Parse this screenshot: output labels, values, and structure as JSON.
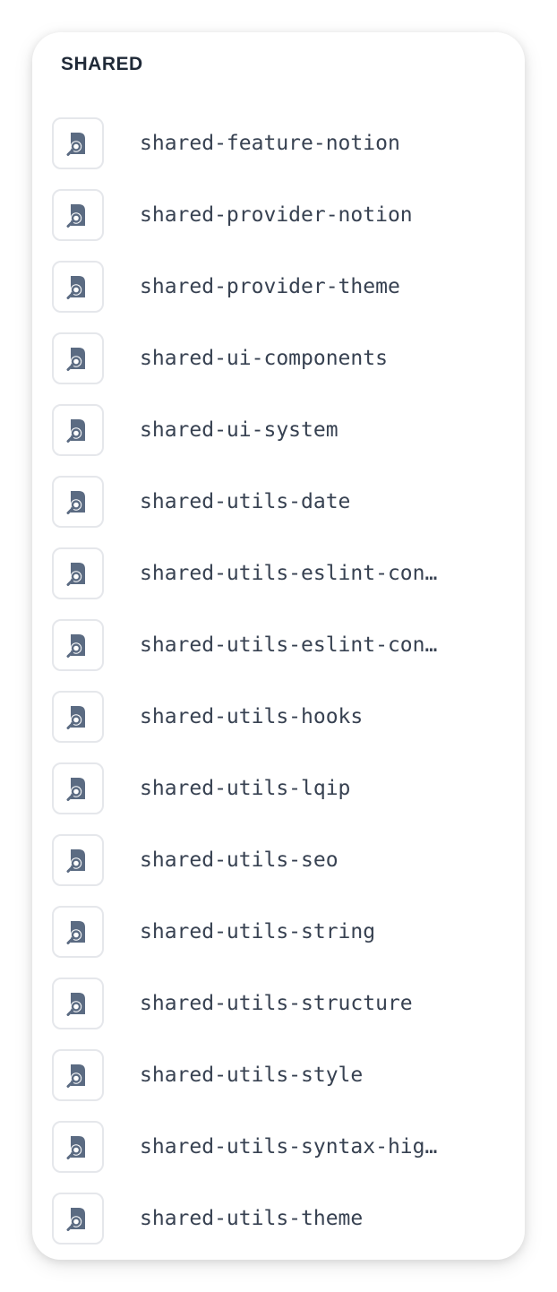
{
  "section": {
    "title": "SHARED"
  },
  "icon": "library-search-icon",
  "colors": {
    "icon": "#5b6b82",
    "text": "#374151",
    "title": "#1f2937",
    "border": "#e5e7eb"
  },
  "items": [
    {
      "label": "shared-feature-notion"
    },
    {
      "label": "shared-provider-notion"
    },
    {
      "label": "shared-provider-theme"
    },
    {
      "label": "shared-ui-components"
    },
    {
      "label": "shared-ui-system"
    },
    {
      "label": "shared-utils-date"
    },
    {
      "label": "shared-utils-eslint-con…"
    },
    {
      "label": "shared-utils-eslint-con…"
    },
    {
      "label": "shared-utils-hooks"
    },
    {
      "label": "shared-utils-lqip"
    },
    {
      "label": "shared-utils-seo"
    },
    {
      "label": "shared-utils-string"
    },
    {
      "label": "shared-utils-structure"
    },
    {
      "label": "shared-utils-style"
    },
    {
      "label": "shared-utils-syntax-hig…"
    },
    {
      "label": "shared-utils-theme"
    }
  ]
}
